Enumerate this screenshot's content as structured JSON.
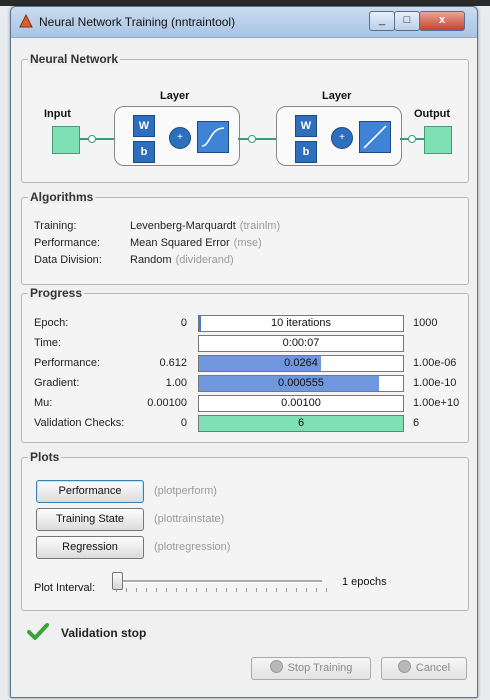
{
  "window": {
    "title": "Neural Network Training (nntraintool)",
    "close_glyph": "x"
  },
  "network": {
    "section_title": "Neural Network",
    "input_label": "Input",
    "output_label": "Output",
    "layer1_label": "Layer",
    "layer2_label": "Layer",
    "weight_label": "W",
    "bias_label": "b",
    "sum_glyph": "+"
  },
  "algorithms": {
    "section_title": "Algorithms",
    "rows": [
      {
        "label": "Training:",
        "value": "Levenberg-Marquardt",
        "fn": "(trainlm)"
      },
      {
        "label": "Performance:",
        "value": "Mean Squared Error",
        "fn": "(mse)"
      },
      {
        "label": "Data Division:",
        "value": "Random",
        "fn": "(dividerand)"
      }
    ]
  },
  "progress": {
    "section_title": "Progress",
    "rows": [
      {
        "label": "Epoch:",
        "start": "0",
        "text": "10 iterations",
        "end": "1000",
        "fill": 0.01,
        "fill_color": "#3f79d1"
      },
      {
        "label": "Time:",
        "start": "",
        "text": "0:00:07",
        "end": "",
        "fill": 0,
        "fill_color": "#3f79d1"
      },
      {
        "label": "Performance:",
        "start": "0.612",
        "text": "0.0264",
        "end": "1.00e-06",
        "fill": 0.6,
        "fill_color": "#6f97de"
      },
      {
        "label": "Gradient:",
        "start": "1.00",
        "text": "0.000555",
        "end": "1.00e-10",
        "fill": 0.88,
        "fill_color": "#6f97de"
      },
      {
        "label": "Mu:",
        "start": "0.00100",
        "text": "0.00100",
        "end": "1.00e+10",
        "fill": 0,
        "fill_color": "#6f97de"
      },
      {
        "label": "Validation Checks:",
        "start": "0",
        "text": "6",
        "end": "6",
        "fill": 1.0,
        "fill_color": "#7fe0b4"
      }
    ]
  },
  "plots": {
    "section_title": "Plots",
    "buttons": [
      {
        "label": "Performance",
        "fn": "(plotperform)"
      },
      {
        "label": "Training State",
        "fn": "(plottrainstate)"
      },
      {
        "label": "Regression",
        "fn": "(plotregression)"
      }
    ],
    "interval_label": "Plot Interval:",
    "interval_value": "1 epochs",
    "interval_fraction": 0.0
  },
  "status": {
    "text": "Validation stop",
    "color": "#3aa33a"
  },
  "footer": {
    "stop_label": "Stop Training",
    "cancel_label": "Cancel"
  }
}
